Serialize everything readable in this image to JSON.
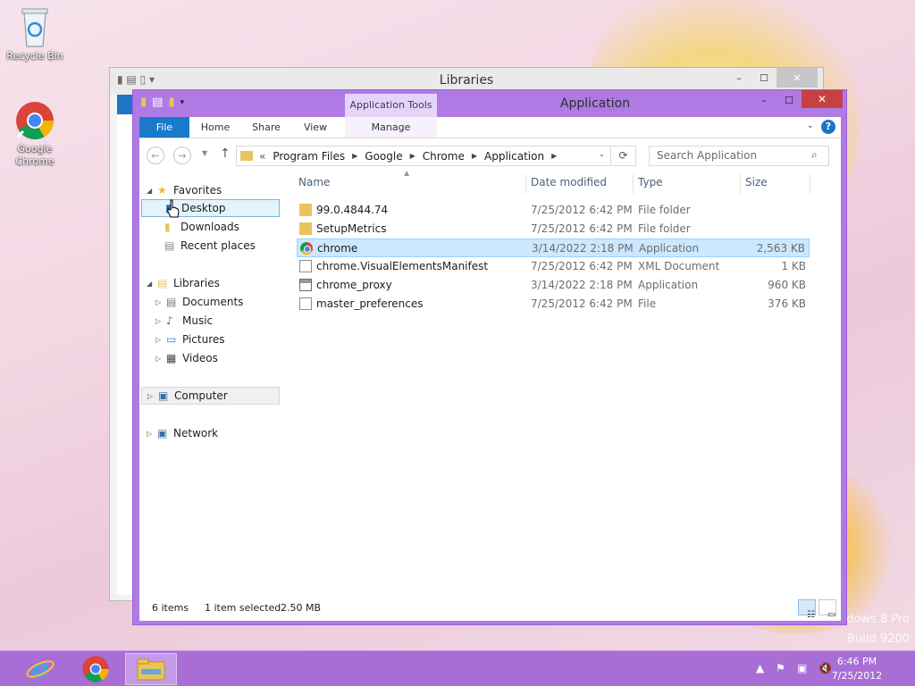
{
  "desktop": {
    "icons": [
      {
        "label": "Recycle Bin"
      },
      {
        "label": "Google Chrome"
      }
    ],
    "watermark": [
      "dows 8 Pro",
      "Build 9200"
    ]
  },
  "back_window": {
    "title": "Libraries"
  },
  "window": {
    "title": "Application",
    "contextual_group": "Application Tools",
    "caption_buttons": {
      "minimize": "–",
      "maximize": "☐",
      "close": "✕"
    }
  },
  "ribbon": {
    "tabs": [
      "File",
      "Home",
      "Share",
      "View",
      "Manage"
    ],
    "help": "?"
  },
  "address_bar": {
    "overflow": "«",
    "crumbs": [
      "Program Files",
      "Google",
      "Chrome",
      "Application"
    ]
  },
  "search": {
    "placeholder": "Search Application"
  },
  "nav_pane": {
    "favorites": {
      "label": "Favorites",
      "items": [
        "Desktop",
        "Downloads",
        "Recent places"
      ]
    },
    "libraries": {
      "label": "Libraries",
      "items": [
        "Documents",
        "Music",
        "Pictures",
        "Videos"
      ]
    },
    "computer": "Computer",
    "network": "Network"
  },
  "file_list": {
    "columns": [
      "Name",
      "Date modified",
      "Type",
      "Size"
    ],
    "rows": [
      {
        "name": "99.0.4844.74",
        "date": "7/25/2012 6:42 PM",
        "type": "File folder",
        "size": "",
        "icon": "folder"
      },
      {
        "name": "SetupMetrics",
        "date": "7/25/2012 6:42 PM",
        "type": "File folder",
        "size": "",
        "icon": "folder"
      },
      {
        "name": "chrome",
        "date": "3/14/2022 2:18 PM",
        "type": "Application",
        "size": "2,563 KB",
        "icon": "chrome"
      },
      {
        "name": "chrome.VisualElementsManifest",
        "date": "7/25/2012 6:42 PM",
        "type": "XML Document",
        "size": "1 KB",
        "icon": "doc"
      },
      {
        "name": "chrome_proxy",
        "date": "3/14/2022 2:18 PM",
        "type": "Application",
        "size": "960 KB",
        "icon": "app"
      },
      {
        "name": "master_preferences",
        "date": "7/25/2012 6:42 PM",
        "type": "File",
        "size": "376 KB",
        "icon": "doc"
      }
    ]
  },
  "status_bar": {
    "count": "6 items",
    "selection": "1 item selected",
    "size": "2.50 MB"
  },
  "taskbar": {
    "clock_time": "6:46 PM",
    "clock_date": "7/25/2012"
  },
  "colors": {
    "accent": "#b07ae5",
    "taskbar": "#a86ed6",
    "file_tab": "#1979ca",
    "selection": "#cce8ff"
  }
}
